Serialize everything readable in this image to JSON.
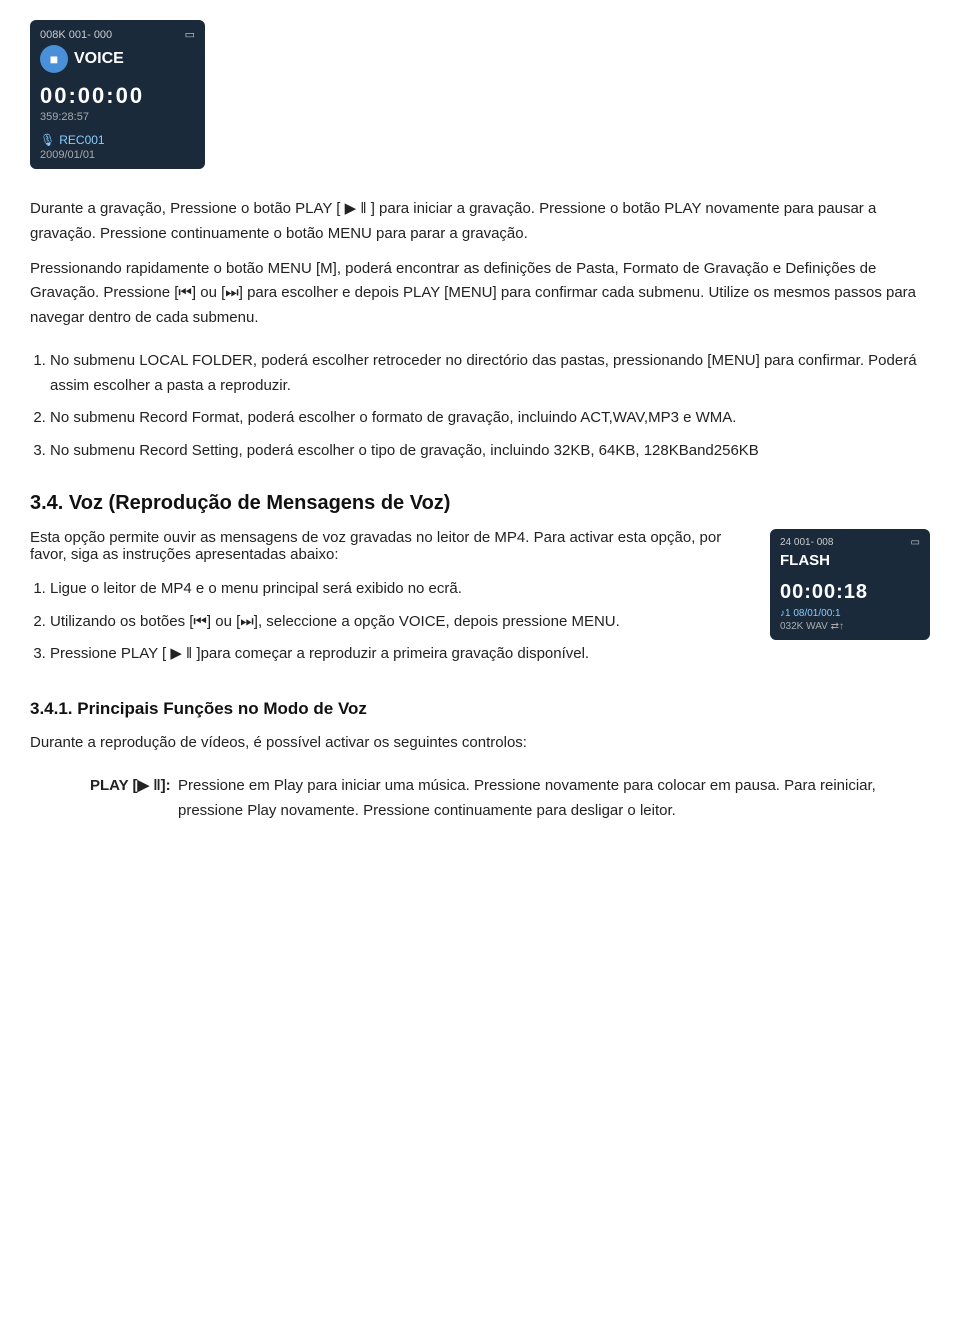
{
  "device1": {
    "top_left": "008K  001- 000",
    "top_right_icon": "□",
    "title": "VOICE",
    "mic_icon": "■",
    "timer": "00:00:00",
    "remaining": "359:28:57",
    "filename": "REC001",
    "date": "2009/01/01"
  },
  "paragraphs": {
    "p1": "Durante a gravação, Pressione o botão PLAY [ ▶ ‖ ] para iniciar a gravação. Pressione o botão PLAY novamente para pausar a gravação. Pressione continuamente o botão MENU para parar a gravação.",
    "p2": "Pressionando rapidamente o botão MENU [M], poderá encontrar as definições de Pasta, Formato de Gravação e Definições de Gravação. Pressione [⏮] ou [⏭] para escolher e depois PLAY [MENU] para confirmar cada submenu. Utilize os mesmos passos para navegar dentro de cada submenu."
  },
  "submenu_list": [
    {
      "num": "1.",
      "text": "No submenu LOCAL FOLDER, poderá escolher retroceder no directório das pastas, pressionando [MENU] para confirmar. Poderá assim escolher a pasta a reproduzir."
    },
    {
      "num": "2.",
      "text": "No submenu Record Format, poderá escolher o formato de gravação, incluindo ACT,WAV,MP3 e WMA."
    },
    {
      "num": "3.",
      "text": "No submenu Record Setting, poderá escolher o tipo de gravação, incluindo 32KB, 64KB, 128KBand256KB"
    }
  ],
  "section_heading": "3.4. Voz (Reprodução de Mensagens de Voz)",
  "section_intro": "Esta opção permite ouvir as mensagens de voz gravadas no leitor de MP4. Para activar esta opção, por favor, siga as instruções apresentadas abaixo:",
  "steps_list": [
    {
      "num": "1.",
      "text": "Ligue o leitor de MP4 e o menu principal será exibido no ecrã."
    },
    {
      "num": "2.",
      "text": "Utilizando os botões [⏮] ou [⏭], seleccione a opção VOICE, depois pressione MENU."
    },
    {
      "num": "3.",
      "text": "Pressione PLAY [ ▶ ‖ ]para começar a reproduzir a primeira gravação disponível."
    }
  ],
  "device2": {
    "top_bar": "24  001- 008",
    "top_right": "□",
    "title": "FLASH",
    "timer": "00:00:18",
    "filename": "♪1 08/01/00:1",
    "formats": "032K  WAV  ⇄↑"
  },
  "sub_heading": "3.4.1.  Principais Funções no Modo de Voz",
  "sub_intro": "Durante a reprodução de vídeos, é possível activar os seguintes controlos:",
  "controls": [
    {
      "key": "PLAY [▶ ‖]:",
      "text": "Pressione em Play para iniciar uma música. Pressione novamente para colocar em pausa. Para reiniciar, pressione Play novamente. Pressione continuamente para desligar o leitor."
    }
  ]
}
